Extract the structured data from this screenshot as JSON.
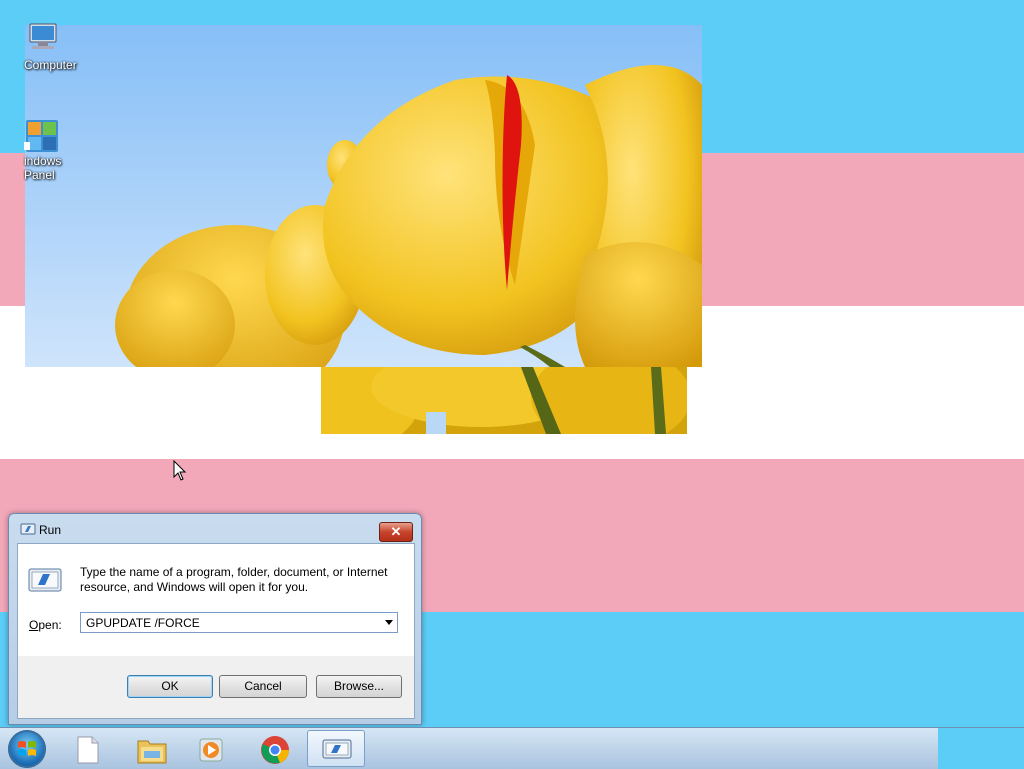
{
  "desktop": {
    "stripe_colors": [
      "#5bcdf7",
      "#f2a8b9",
      "#ffffff",
      "#f2a8b9",
      "#5bcdf7"
    ],
    "icons": [
      {
        "name": "computer-icon",
        "label": "Computer"
      },
      {
        "name": "control-panel-icon",
        "label": "indows\nPanel"
      }
    ]
  },
  "run_dialog": {
    "title": "Run",
    "close_glyph": "✕",
    "description": "Type the name of a program, folder, document, or Internet resource, and Windows will open it for you.",
    "open_label": "Open:",
    "open_label_accesskey": "O",
    "open_label_rest": "pen:",
    "command_value": "GPUPDATE /FORCE",
    "buttons": {
      "ok": "OK",
      "cancel": "Cancel",
      "browse": "Browse..."
    }
  },
  "taskbar": {
    "items": [
      {
        "name": "start-button"
      },
      {
        "name": "notepad-taskbar-icon"
      },
      {
        "name": "file-explorer-taskbar-icon"
      },
      {
        "name": "media-player-taskbar-icon"
      },
      {
        "name": "chrome-taskbar-icon"
      },
      {
        "name": "run-taskbar-icon",
        "active": true
      }
    ]
  }
}
